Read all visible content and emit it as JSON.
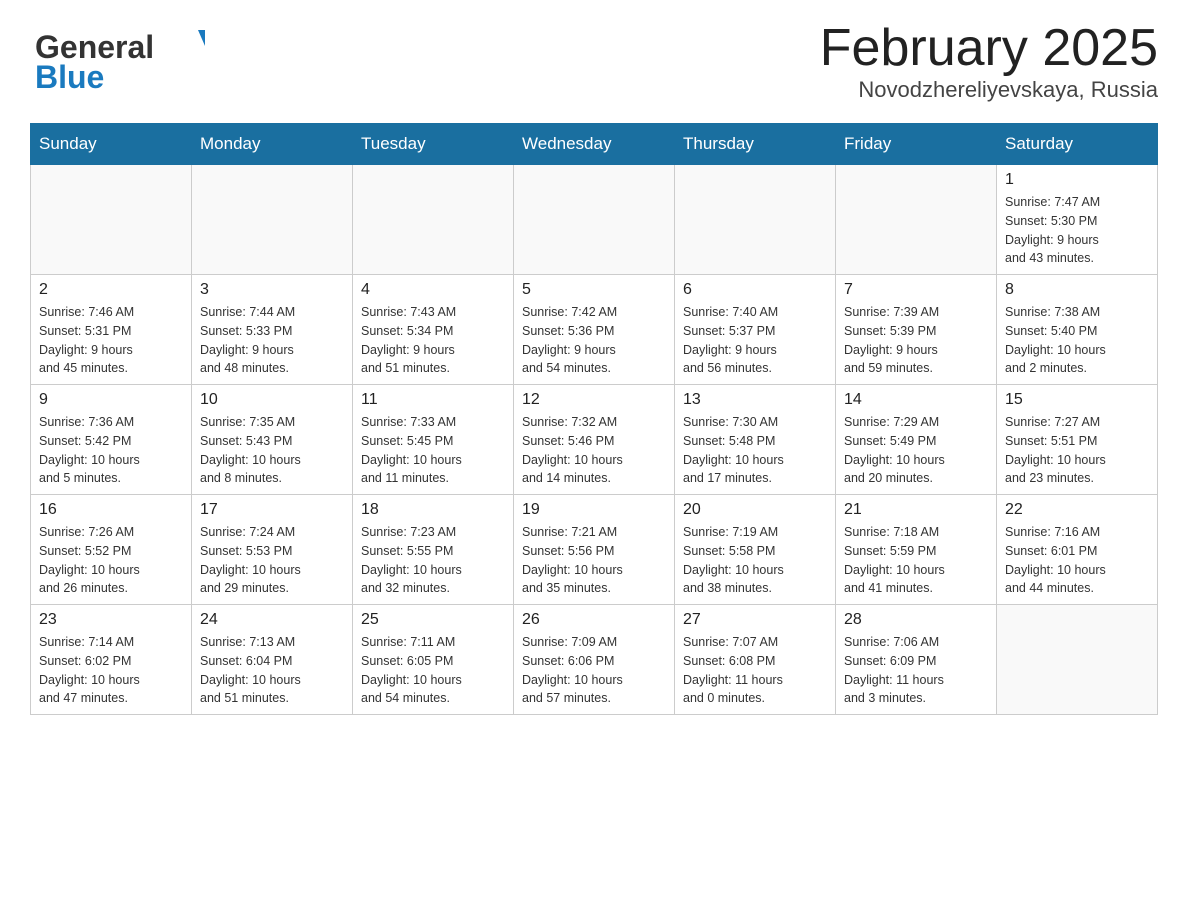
{
  "header": {
    "logo_general": "General",
    "logo_blue": "Blue",
    "month_title": "February 2025",
    "location": "Novodzhereliyevskaya, Russia"
  },
  "days_of_week": [
    "Sunday",
    "Monday",
    "Tuesday",
    "Wednesday",
    "Thursday",
    "Friday",
    "Saturday"
  ],
  "weeks": [
    [
      {
        "day": "",
        "info": ""
      },
      {
        "day": "",
        "info": ""
      },
      {
        "day": "",
        "info": ""
      },
      {
        "day": "",
        "info": ""
      },
      {
        "day": "",
        "info": ""
      },
      {
        "day": "",
        "info": ""
      },
      {
        "day": "1",
        "info": "Sunrise: 7:47 AM\nSunset: 5:30 PM\nDaylight: 9 hours\nand 43 minutes."
      }
    ],
    [
      {
        "day": "2",
        "info": "Sunrise: 7:46 AM\nSunset: 5:31 PM\nDaylight: 9 hours\nand 45 minutes."
      },
      {
        "day": "3",
        "info": "Sunrise: 7:44 AM\nSunset: 5:33 PM\nDaylight: 9 hours\nand 48 minutes."
      },
      {
        "day": "4",
        "info": "Sunrise: 7:43 AM\nSunset: 5:34 PM\nDaylight: 9 hours\nand 51 minutes."
      },
      {
        "day": "5",
        "info": "Sunrise: 7:42 AM\nSunset: 5:36 PM\nDaylight: 9 hours\nand 54 minutes."
      },
      {
        "day": "6",
        "info": "Sunrise: 7:40 AM\nSunset: 5:37 PM\nDaylight: 9 hours\nand 56 minutes."
      },
      {
        "day": "7",
        "info": "Sunrise: 7:39 AM\nSunset: 5:39 PM\nDaylight: 9 hours\nand 59 minutes."
      },
      {
        "day": "8",
        "info": "Sunrise: 7:38 AM\nSunset: 5:40 PM\nDaylight: 10 hours\nand 2 minutes."
      }
    ],
    [
      {
        "day": "9",
        "info": "Sunrise: 7:36 AM\nSunset: 5:42 PM\nDaylight: 10 hours\nand 5 minutes."
      },
      {
        "day": "10",
        "info": "Sunrise: 7:35 AM\nSunset: 5:43 PM\nDaylight: 10 hours\nand 8 minutes."
      },
      {
        "day": "11",
        "info": "Sunrise: 7:33 AM\nSunset: 5:45 PM\nDaylight: 10 hours\nand 11 minutes."
      },
      {
        "day": "12",
        "info": "Sunrise: 7:32 AM\nSunset: 5:46 PM\nDaylight: 10 hours\nand 14 minutes."
      },
      {
        "day": "13",
        "info": "Sunrise: 7:30 AM\nSunset: 5:48 PM\nDaylight: 10 hours\nand 17 minutes."
      },
      {
        "day": "14",
        "info": "Sunrise: 7:29 AM\nSunset: 5:49 PM\nDaylight: 10 hours\nand 20 minutes."
      },
      {
        "day": "15",
        "info": "Sunrise: 7:27 AM\nSunset: 5:51 PM\nDaylight: 10 hours\nand 23 minutes."
      }
    ],
    [
      {
        "day": "16",
        "info": "Sunrise: 7:26 AM\nSunset: 5:52 PM\nDaylight: 10 hours\nand 26 minutes."
      },
      {
        "day": "17",
        "info": "Sunrise: 7:24 AM\nSunset: 5:53 PM\nDaylight: 10 hours\nand 29 minutes."
      },
      {
        "day": "18",
        "info": "Sunrise: 7:23 AM\nSunset: 5:55 PM\nDaylight: 10 hours\nand 32 minutes."
      },
      {
        "day": "19",
        "info": "Sunrise: 7:21 AM\nSunset: 5:56 PM\nDaylight: 10 hours\nand 35 minutes."
      },
      {
        "day": "20",
        "info": "Sunrise: 7:19 AM\nSunset: 5:58 PM\nDaylight: 10 hours\nand 38 minutes."
      },
      {
        "day": "21",
        "info": "Sunrise: 7:18 AM\nSunset: 5:59 PM\nDaylight: 10 hours\nand 41 minutes."
      },
      {
        "day": "22",
        "info": "Sunrise: 7:16 AM\nSunset: 6:01 PM\nDaylight: 10 hours\nand 44 minutes."
      }
    ],
    [
      {
        "day": "23",
        "info": "Sunrise: 7:14 AM\nSunset: 6:02 PM\nDaylight: 10 hours\nand 47 minutes."
      },
      {
        "day": "24",
        "info": "Sunrise: 7:13 AM\nSunset: 6:04 PM\nDaylight: 10 hours\nand 51 minutes."
      },
      {
        "day": "25",
        "info": "Sunrise: 7:11 AM\nSunset: 6:05 PM\nDaylight: 10 hours\nand 54 minutes."
      },
      {
        "day": "26",
        "info": "Sunrise: 7:09 AM\nSunset: 6:06 PM\nDaylight: 10 hours\nand 57 minutes."
      },
      {
        "day": "27",
        "info": "Sunrise: 7:07 AM\nSunset: 6:08 PM\nDaylight: 11 hours\nand 0 minutes."
      },
      {
        "day": "28",
        "info": "Sunrise: 7:06 AM\nSunset: 6:09 PM\nDaylight: 11 hours\nand 3 minutes."
      },
      {
        "day": "",
        "info": ""
      }
    ]
  ]
}
